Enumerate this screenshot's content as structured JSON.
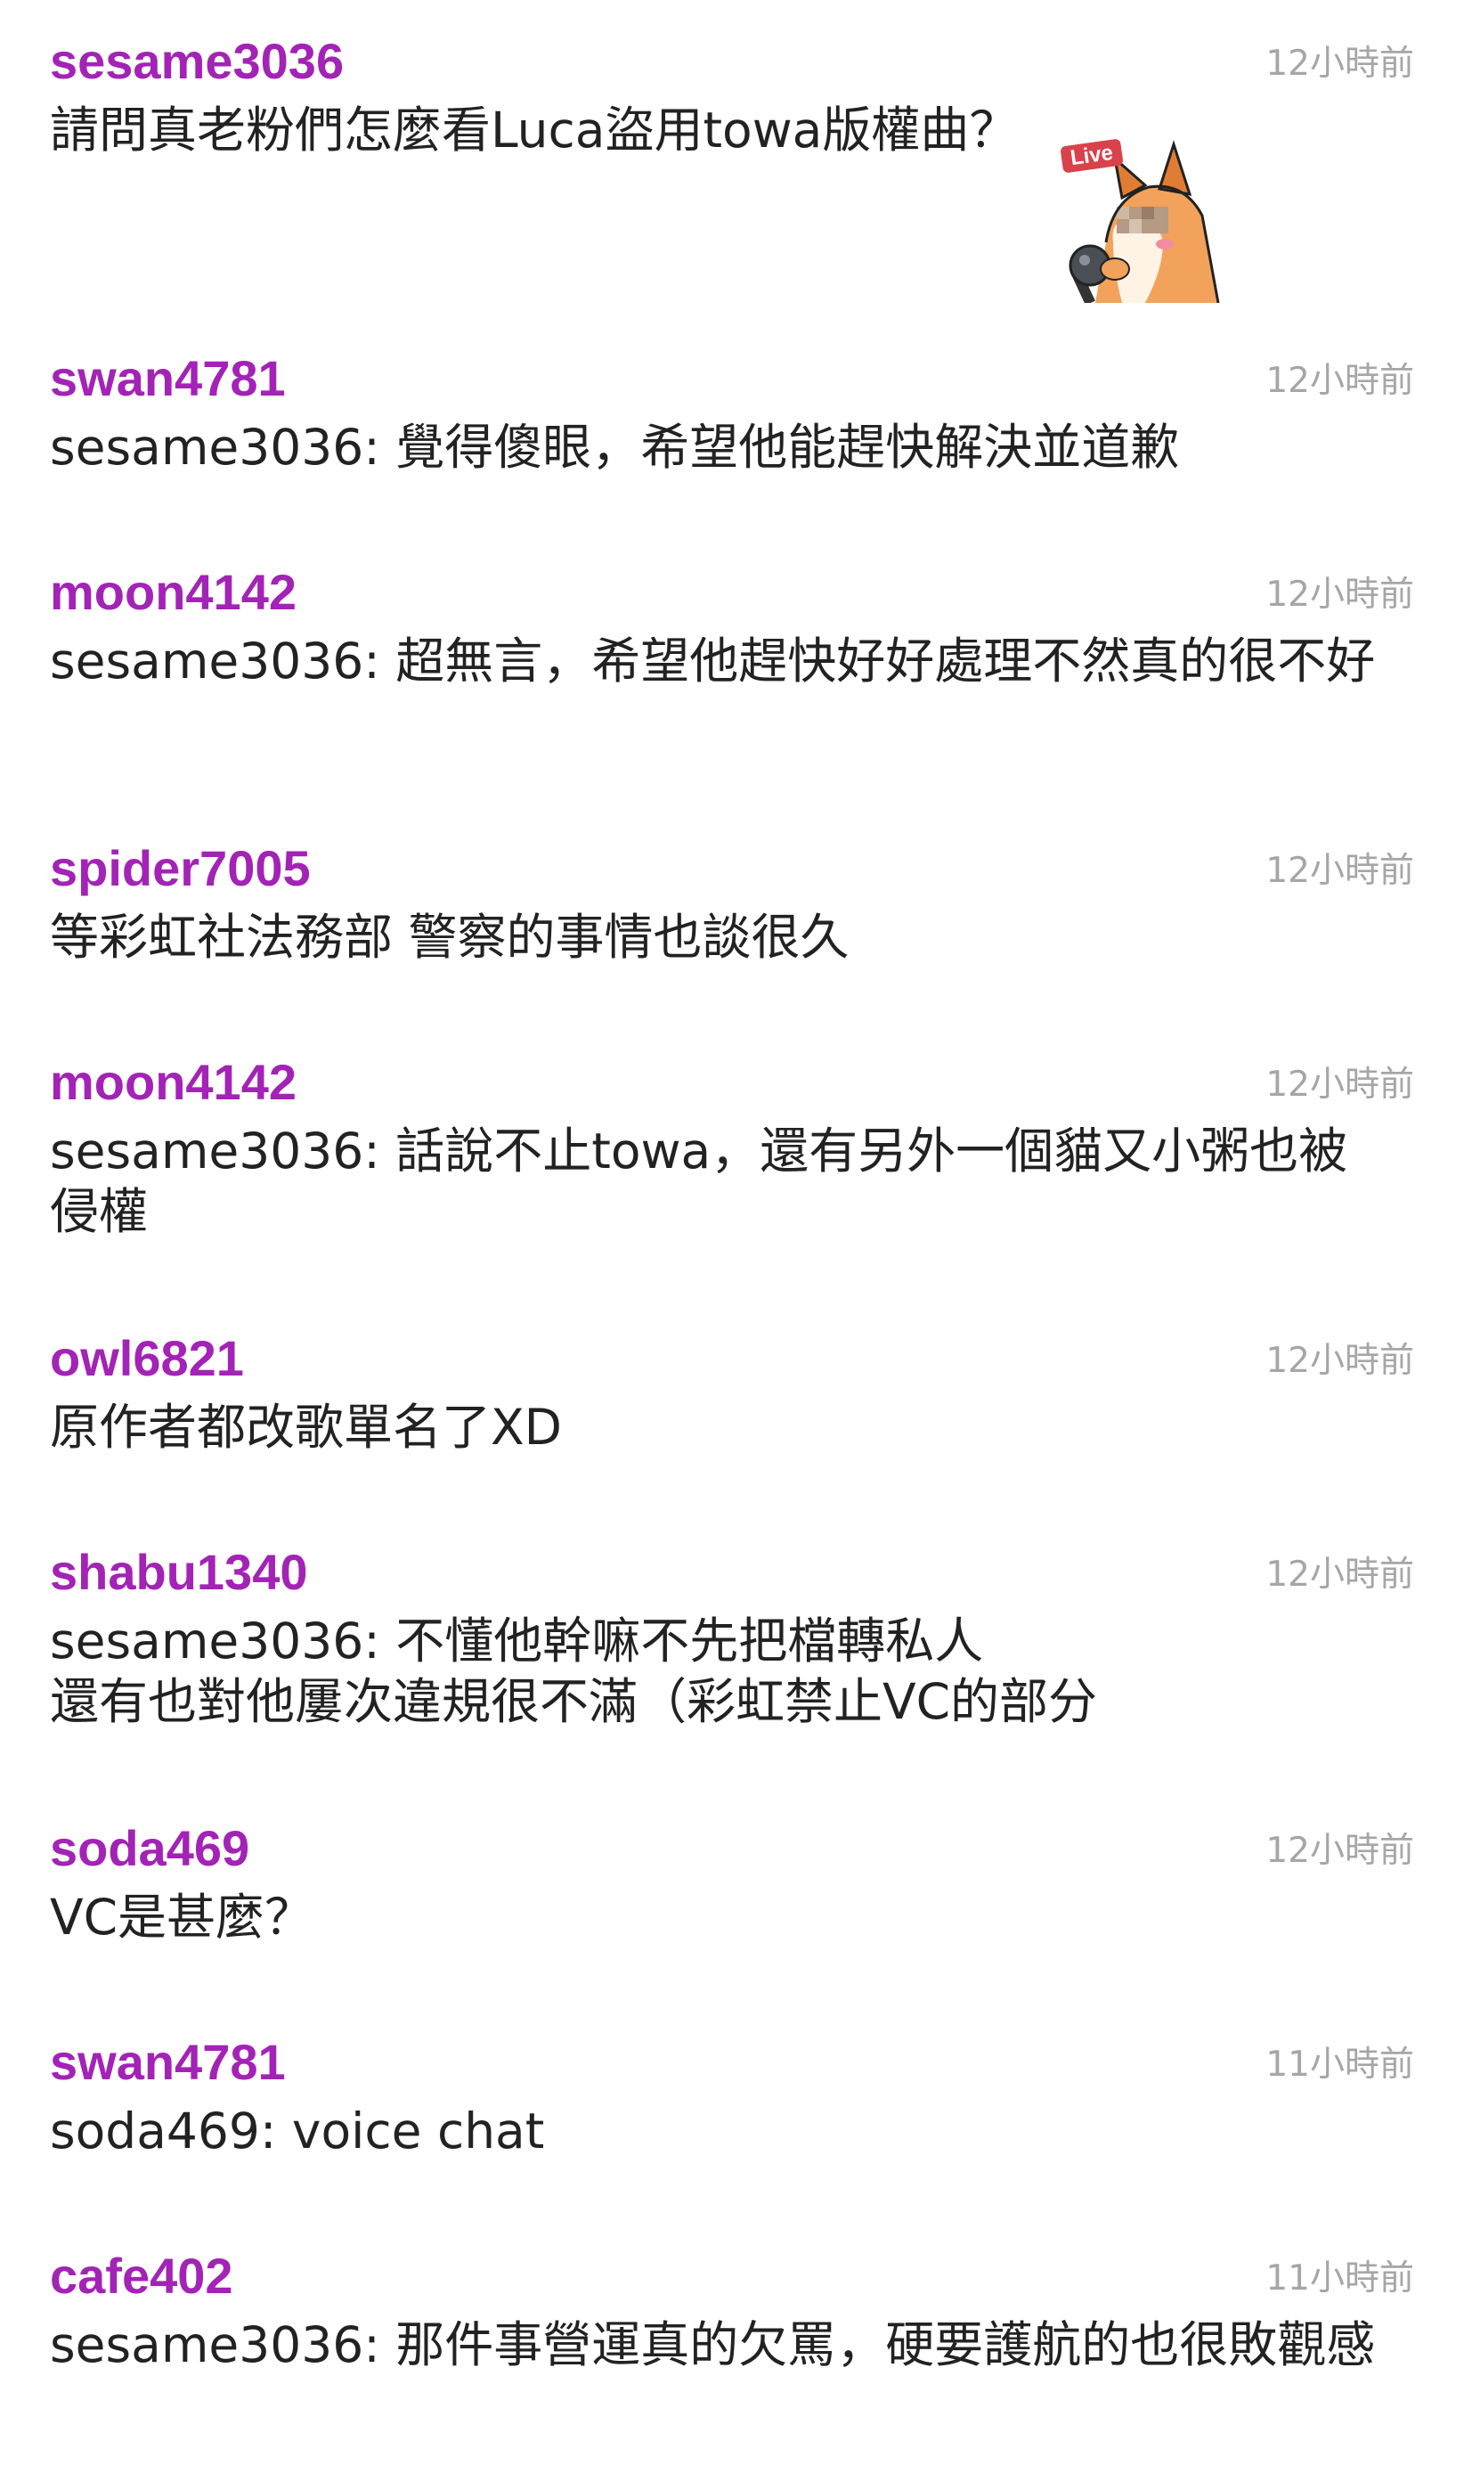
{
  "comments": [
    {
      "user": "sesame3036",
      "time": "12小時前",
      "text": "請問真老粉們怎麼看Luca盜用towa版權曲？"
    },
    {
      "user": "swan4781",
      "time": "12小時前",
      "text": "sesame3036: 覺得傻眼，希望他能趕快解決並道歉"
    },
    {
      "user": "moon4142",
      "time": "12小時前",
      "text": "sesame3036: 超無言，希望他趕快好好處理不然真的很不好"
    },
    {
      "user": "spider7005",
      "time": "12小時前",
      "text": "等彩虹社法務部 警察的事情也談很久"
    },
    {
      "user": "moon4142",
      "time": "12小時前",
      "text": "sesame3036: 話說不止towa，還有另外一個貓又小粥也被侵權"
    },
    {
      "user": "owl6821",
      "time": "12小時前",
      "text": "原作者都改歌單名了XD"
    },
    {
      "user": "shabu1340",
      "time": "12小時前",
      "text": "sesame3036: 不懂他幹嘛不先把檔轉私人\n還有也對他屢次違規很不滿（彩虹禁止VC的部分"
    },
    {
      "user": "soda469",
      "time": "12小時前",
      "text": "VC是甚麼？"
    },
    {
      "user": "swan4781",
      "time": "11小時前",
      "text": "soda469: voice chat"
    },
    {
      "user": "cafe402",
      "time": "11小時前",
      "text": "sesame3036: 那件事營運真的欠罵，硬要護航的也很敗觀感"
    }
  ],
  "sticker": {
    "icon": "fox-singing-sticker-icon",
    "badge": "Live"
  },
  "colors": {
    "username": "#a323b6",
    "timestamp": "#a6a6a6",
    "text": "#222222",
    "background": "#ffffff"
  }
}
